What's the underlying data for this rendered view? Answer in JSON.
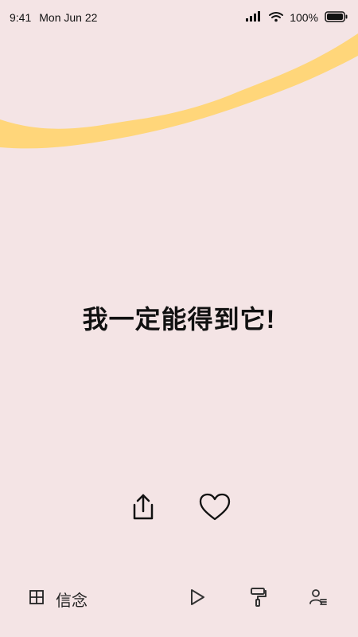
{
  "status_bar": {
    "time": "9:41",
    "date": "Mon Jun 22",
    "battery": "100%",
    "icons": [
      "signal-icon",
      "wifi-icon",
      "battery-icon"
    ]
  },
  "main": {
    "quote": "我一定能得到它!"
  },
  "actions": {
    "icons": [
      "share-icon",
      "heart-icon"
    ]
  },
  "bottom_bar": {
    "label": "信念",
    "icons": [
      "grid-icon",
      "play-icon",
      "paint-roller-icon",
      "profile-list-icon"
    ]
  },
  "colors": {
    "background": "#f4e4e5",
    "accent_stroke": "#ffd67a",
    "text": "#111111"
  }
}
